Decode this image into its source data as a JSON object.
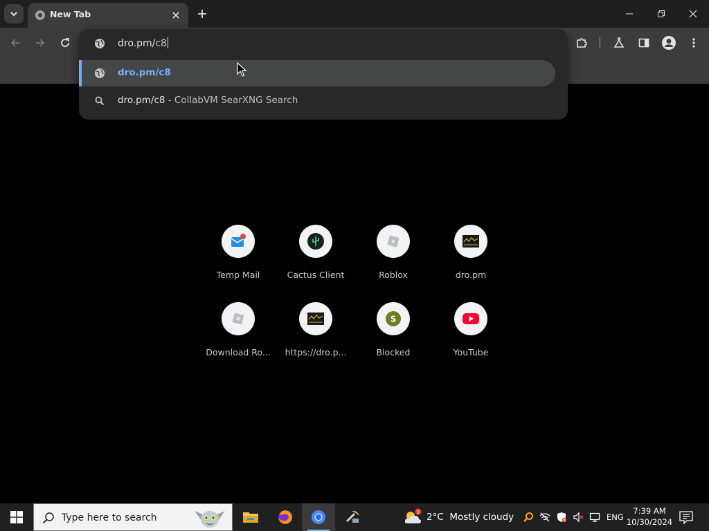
{
  "browser": {
    "tab": {
      "title": "New Tab"
    },
    "omnibox": {
      "input_primary": "dro.pm/",
      "input_secondary": "c8",
      "suggestions": [
        {
          "text": "dro.pm/c8",
          "type": "url",
          "selected": true
        },
        {
          "text": "dro.pm/c8",
          "separator": " - ",
          "provider": "CollabVM SearXNG Search",
          "type": "search"
        }
      ]
    },
    "accent_color": "#7cacf8"
  },
  "shortcuts": [
    {
      "title": "Temp Mail",
      "icon": "temp-mail-icon"
    },
    {
      "title": "Cactus Client",
      "icon": "cactus-client-icon"
    },
    {
      "title": "Roblox",
      "icon": "roblox-icon"
    },
    {
      "title": "dro.pm",
      "icon": "dro-pm-icon"
    },
    {
      "title": "Download Ro...",
      "icon": "roblox-icon"
    },
    {
      "title": "https://dro.p...",
      "icon": "dro-pm-icon"
    },
    {
      "title": "Blocked",
      "icon": "blocked-s-icon"
    },
    {
      "title": "YouTube",
      "icon": "youtube-icon"
    }
  ],
  "taskbar": {
    "search_placeholder": "Type here to search",
    "weather": {
      "temp": "2°C",
      "condition": "Mostly cloudy"
    },
    "language": "ENG",
    "time": "7:39 AM",
    "date": "10/30/2024"
  }
}
